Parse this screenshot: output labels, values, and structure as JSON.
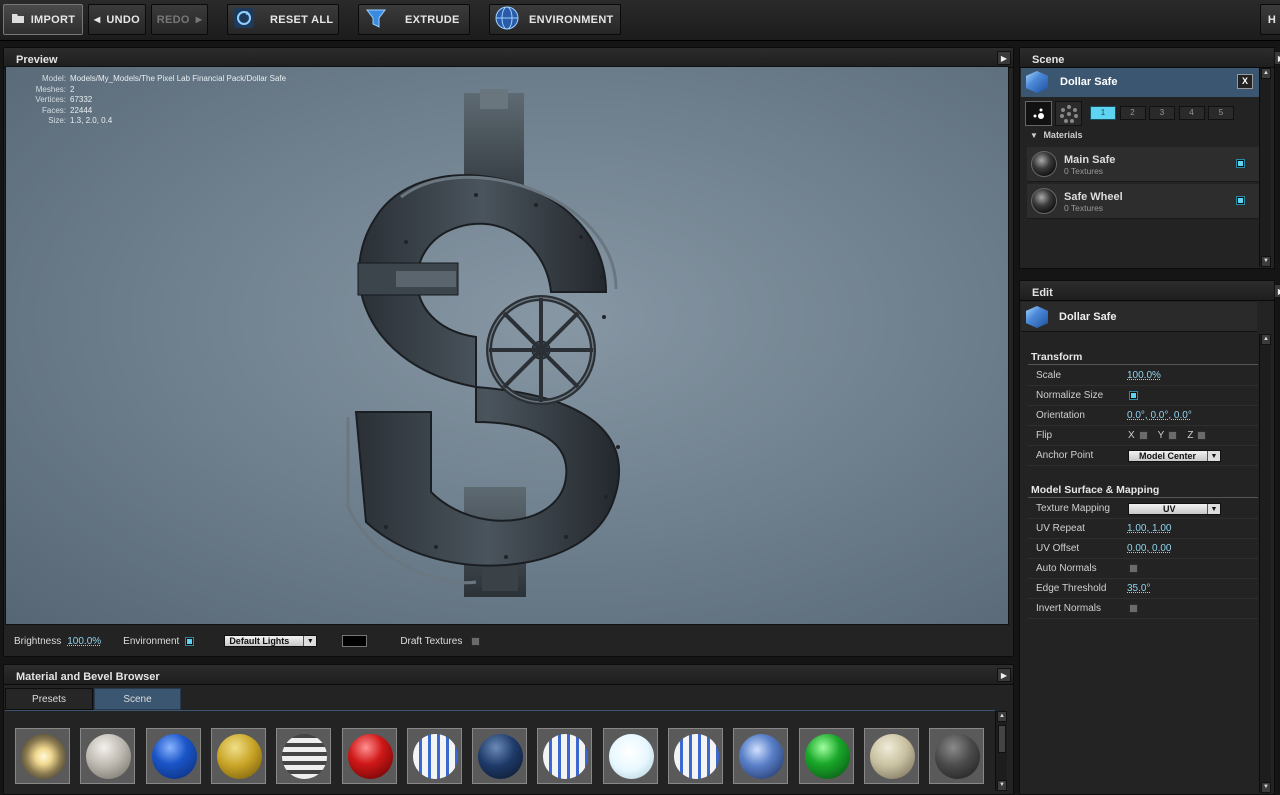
{
  "toolbar": {
    "import": "IMPORT",
    "undo": "UNDO",
    "redo": "REDO",
    "reset_all": "RESET ALL",
    "extrude": "EXTRUDE",
    "environment": "ENVIRONMENT",
    "right_btn": "H"
  },
  "preview": {
    "title": "Preview",
    "info": [
      {
        "k": "Model:",
        "v": "Models/My_Models/The Pixel Lab Financial Pack/Dollar Safe"
      },
      {
        "k": "Meshes:",
        "v": "2"
      },
      {
        "k": "Vertices:",
        "v": "67332"
      },
      {
        "k": "Faces:",
        "v": "22444"
      },
      {
        "k": "Size:",
        "v": "1.3, 2.0, 0.4"
      }
    ],
    "brightness_label": "Brightness",
    "brightness_value": "100.0%",
    "environment_label": "Environment",
    "environment_checked": true,
    "lights_dropdown": "Default Lights",
    "draft_textures_label": "Draft Textures",
    "draft_textures_checked": false
  },
  "browser": {
    "title": "Material and Bevel Browser",
    "tabs": [
      {
        "label": "Presets",
        "active": false
      },
      {
        "label": "Scene",
        "active": true
      }
    ],
    "spheres": [
      {
        "icon": "glow-sphere-icon",
        "bg": "radial-gradient(circle at 50% 50%,#fff8d8 0%,#f0d890 25%,#8a7a50 55%,#222 100%)"
      },
      {
        "icon": "gray-sphere-icon",
        "bg": "radial-gradient(circle at 40% 30%,#f4f0ec 0%,#bdb8b0 45%,#6b6760 100%)"
      },
      {
        "icon": "blue-sphere-icon",
        "bg": "radial-gradient(circle at 40% 30%,#8ab4ff 0%,#1a55c8 40%,#0a2a70 100%)"
      },
      {
        "icon": "gold-sphere-icon",
        "bg": "radial-gradient(circle at 40% 30%,#f0e08a 0%,#c8a426 45%,#6a5208 100%)"
      },
      {
        "icon": "striped-sphere-icon",
        "bg": "repeating-linear-gradient(0deg,#eee 0 5px,#444 5px 9px)"
      },
      {
        "icon": "red-sphere-icon",
        "bg": "radial-gradient(circle at 40% 30%,#ff9090 0%,#d01818 40%,#5a0000 100%)"
      },
      {
        "icon": "flag-sphere-icon",
        "bg": "repeating-linear-gradient(90deg,#f4f4f4 0 6px,#3a6ad0 6px 9px)"
      },
      {
        "icon": "navy-sphere-icon",
        "bg": "radial-gradient(circle at 40% 30%,#6a8ab8 0%,#1e3a68 45%,#0a1628 100%)"
      },
      {
        "icon": "flag-sphere-icon",
        "bg": "repeating-linear-gradient(90deg,#f4f4f4 0 6px,#3a6ad0 6px 9px)"
      },
      {
        "icon": "white-sphere-icon",
        "bg": "radial-gradient(circle at 45% 40%,#ffffff 0%,#e8f8ff 50%,#a8c8d8 100%)"
      },
      {
        "icon": "flag-sphere-icon",
        "bg": "repeating-linear-gradient(90deg,#f4f4f4 0 6px,#3a6ad0 6px 9px)"
      },
      {
        "icon": "chrome-blue-sphere-icon",
        "bg": "radial-gradient(circle at 40% 35%,#d0e0ff 0%,#5a80c8 40%,#1a2a58 100%)"
      },
      {
        "icon": "green-sphere-icon",
        "bg": "radial-gradient(circle at 40% 30%,#a0ffa0 0%,#1aa82a 40%,#064a10 100%)"
      },
      {
        "icon": "beige-sphere-icon",
        "bg": "radial-gradient(circle at 40% 30%,#f0ecd8 0%,#c8c0a0 45%,#6a6450 100%)"
      },
      {
        "icon": "dark-sphere-icon",
        "bg": "radial-gradient(circle at 40% 30%,#8a8a8a 0%,#4a4a4a 45%,#1a1a1a 100%)"
      }
    ]
  },
  "scene": {
    "title": "Scene",
    "object_name": "Dollar Safe",
    "close_label": "X",
    "layers": [
      "1",
      "2",
      "3",
      "4",
      "5"
    ],
    "active_layer": "1",
    "materials_header": "Materials",
    "materials": [
      {
        "name": "Main Safe",
        "textures": "0 Textures",
        "checked": true
      },
      {
        "name": "Safe Wheel",
        "textures": "0 Textures",
        "checked": true
      }
    ]
  },
  "edit": {
    "title": "Edit",
    "object_name": "Dollar Safe",
    "transform_header": "Transform",
    "scale_label": "Scale",
    "scale_value": "100.0%",
    "normalize_label": "Normalize Size",
    "normalize_checked": true,
    "orientation_label": "Orientation",
    "orientation_value": "0.0°, 0.0°, 0.0°",
    "flip_label": "Flip",
    "flip_x": "X",
    "flip_y": "Y",
    "flip_z": "Z",
    "anchor_label": "Anchor Point",
    "anchor_value": "Model Center",
    "surface_header": "Model Surface & Mapping",
    "texture_mapping_label": "Texture Mapping",
    "texture_mapping_value": "UV",
    "uv_repeat_label": "UV Repeat",
    "uv_repeat_value": "1.00, 1.00",
    "uv_offset_label": "UV Offset",
    "uv_offset_value": "0.00, 0.00",
    "auto_normals_label": "Auto Normals",
    "edge_threshold_label": "Edge Threshold",
    "edge_threshold_value": "35.0°",
    "invert_normals_label": "Invert Normals"
  },
  "colors": {
    "accent": "#5fd4f0",
    "panel": "#232323",
    "viewport": "#7b8b98"
  }
}
